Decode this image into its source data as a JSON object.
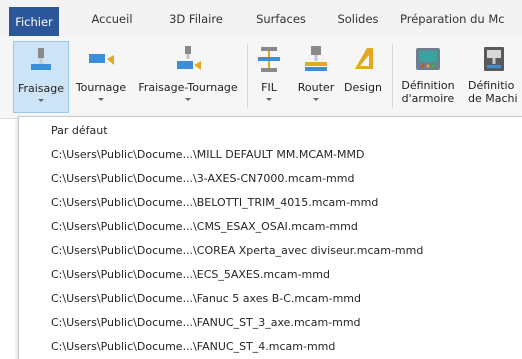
{
  "tabs": [
    {
      "label": "Fichier",
      "active": true
    },
    {
      "label": "Accueil"
    },
    {
      "label": "3D Filaire"
    },
    {
      "label": "Surfaces"
    },
    {
      "label": "Solides"
    },
    {
      "label": "Préparation du Mc"
    }
  ],
  "ribbon": {
    "buttons": [
      {
        "label": "Fraisage",
        "icon": "milling-icon",
        "selected": true
      },
      {
        "label": "Tournage",
        "icon": "lathe-icon"
      },
      {
        "label": "Fraisage-Tournage",
        "icon": "mill-turn-icon"
      },
      {
        "label": "FIL",
        "icon": "wire-edm-icon"
      },
      {
        "label": "Router",
        "icon": "router-icon"
      },
      {
        "label": "Design",
        "icon": "design-icon"
      },
      {
        "label": "Définition\nd'armoire",
        "icon": "control-cabinet-icon"
      },
      {
        "label": "Définitio\nde Machi",
        "icon": "machine-definition-icon"
      }
    ]
  },
  "menu": {
    "items": [
      "Par défaut",
      "C:\\Users\\Public\\Docume...\\MILL DEFAULT MM.MCAM-MMD",
      "C:\\Users\\Public\\Docume...\\3-AXES-CN7000.mcam-mmd",
      "C:\\Users\\Public\\Docume...\\BELOTTI_TRIM_4015.mcam-mmd",
      "C:\\Users\\Public\\Docume...\\CMS_ESAX_OSAI.mcam-mmd",
      "C:\\Users\\Public\\Docume...\\COREA Xperta_avec diviseur.mcam-mmd",
      "C:\\Users\\Public\\Docume...\\ECS_5AXES.mcam-mmd",
      "C:\\Users\\Public\\Docume...\\Fanuc 5 axes B-C.mcam-mmd",
      "C:\\Users\\Public\\Docume...\\FANUC_ST_3_axe.mcam-mmd",
      "C:\\Users\\Public\\Docume...\\FANUC_ST_4.mcam-mmd"
    ]
  },
  "colors": {
    "accent": "#2b579a",
    "selected_bg": "#cde4f7"
  }
}
